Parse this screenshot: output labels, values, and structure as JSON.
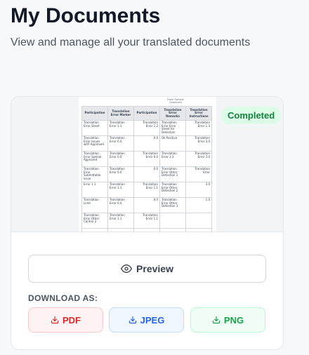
{
  "header": {
    "title": "My Documents",
    "subtitle": "View and manage all your translated documents"
  },
  "card": {
    "status": "Completed",
    "preview_label": "Preview",
    "download_heading": "DOWNLOAD AS:",
    "downloads": [
      {
        "label": "PDF",
        "color": "#dc2626",
        "icon": "download-icon"
      },
      {
        "label": "JPEG",
        "color": "#2563eb",
        "icon": "download-icon"
      },
      {
        "label": "PNG",
        "color": "#16a34a",
        "icon": "download-icon"
      }
    ]
  },
  "document_thumbnail": {
    "heading": "Each Sample Observed",
    "columns": [
      "Participation",
      "Translation Error Marker",
      "Participation",
      "Translation Error Remarks",
      "Translation Error Instructions"
    ],
    "rows": [
      [
        "Translation Error Sheet",
        "Translation Error 1.1",
        "Translation Error 1.2",
        "Translation Error Error Sheet for Detection",
        "Translation Error 1.3"
      ],
      [
        "Translation Error Issues with Approved",
        "Translation Error 0.0",
        "0.0",
        "Ok Positive",
        "Translation Error 3.0"
      ],
      [
        "Translation Error Special Approved",
        "Translation Error 0.0",
        "Translation Error 0.0",
        "Translation Error 1.3",
        "Translation Error 3.0"
      ],
      [
        "Translation Error Submittable Issue",
        "Translation Error 0.0",
        "0.0",
        "Translation Error Other Detection 1",
        "Translation Error"
      ],
      [
        "Error 1.1",
        "Translation Error 1.1",
        "Translation Error 1.1",
        "Translation Error Other Detection 2",
        "3.0"
      ],
      [
        "Translation Limit",
        "Translation Error 0.0",
        "0.0",
        "Translation Error Other Detection 3",
        "1.0"
      ],
      [
        "Translation Error Other Control 2",
        "Translation Error 1.1",
        "Translation Error 1.1",
        "",
        ""
      ],
      [
        "",
        "",
        "",
        "",
        ""
      ]
    ]
  },
  "colors": {
    "status_bg": "#dcfce7",
    "status_text": "#15803d",
    "pdf": "#dc2626",
    "jpeg": "#2563eb",
    "png": "#16a34a"
  }
}
